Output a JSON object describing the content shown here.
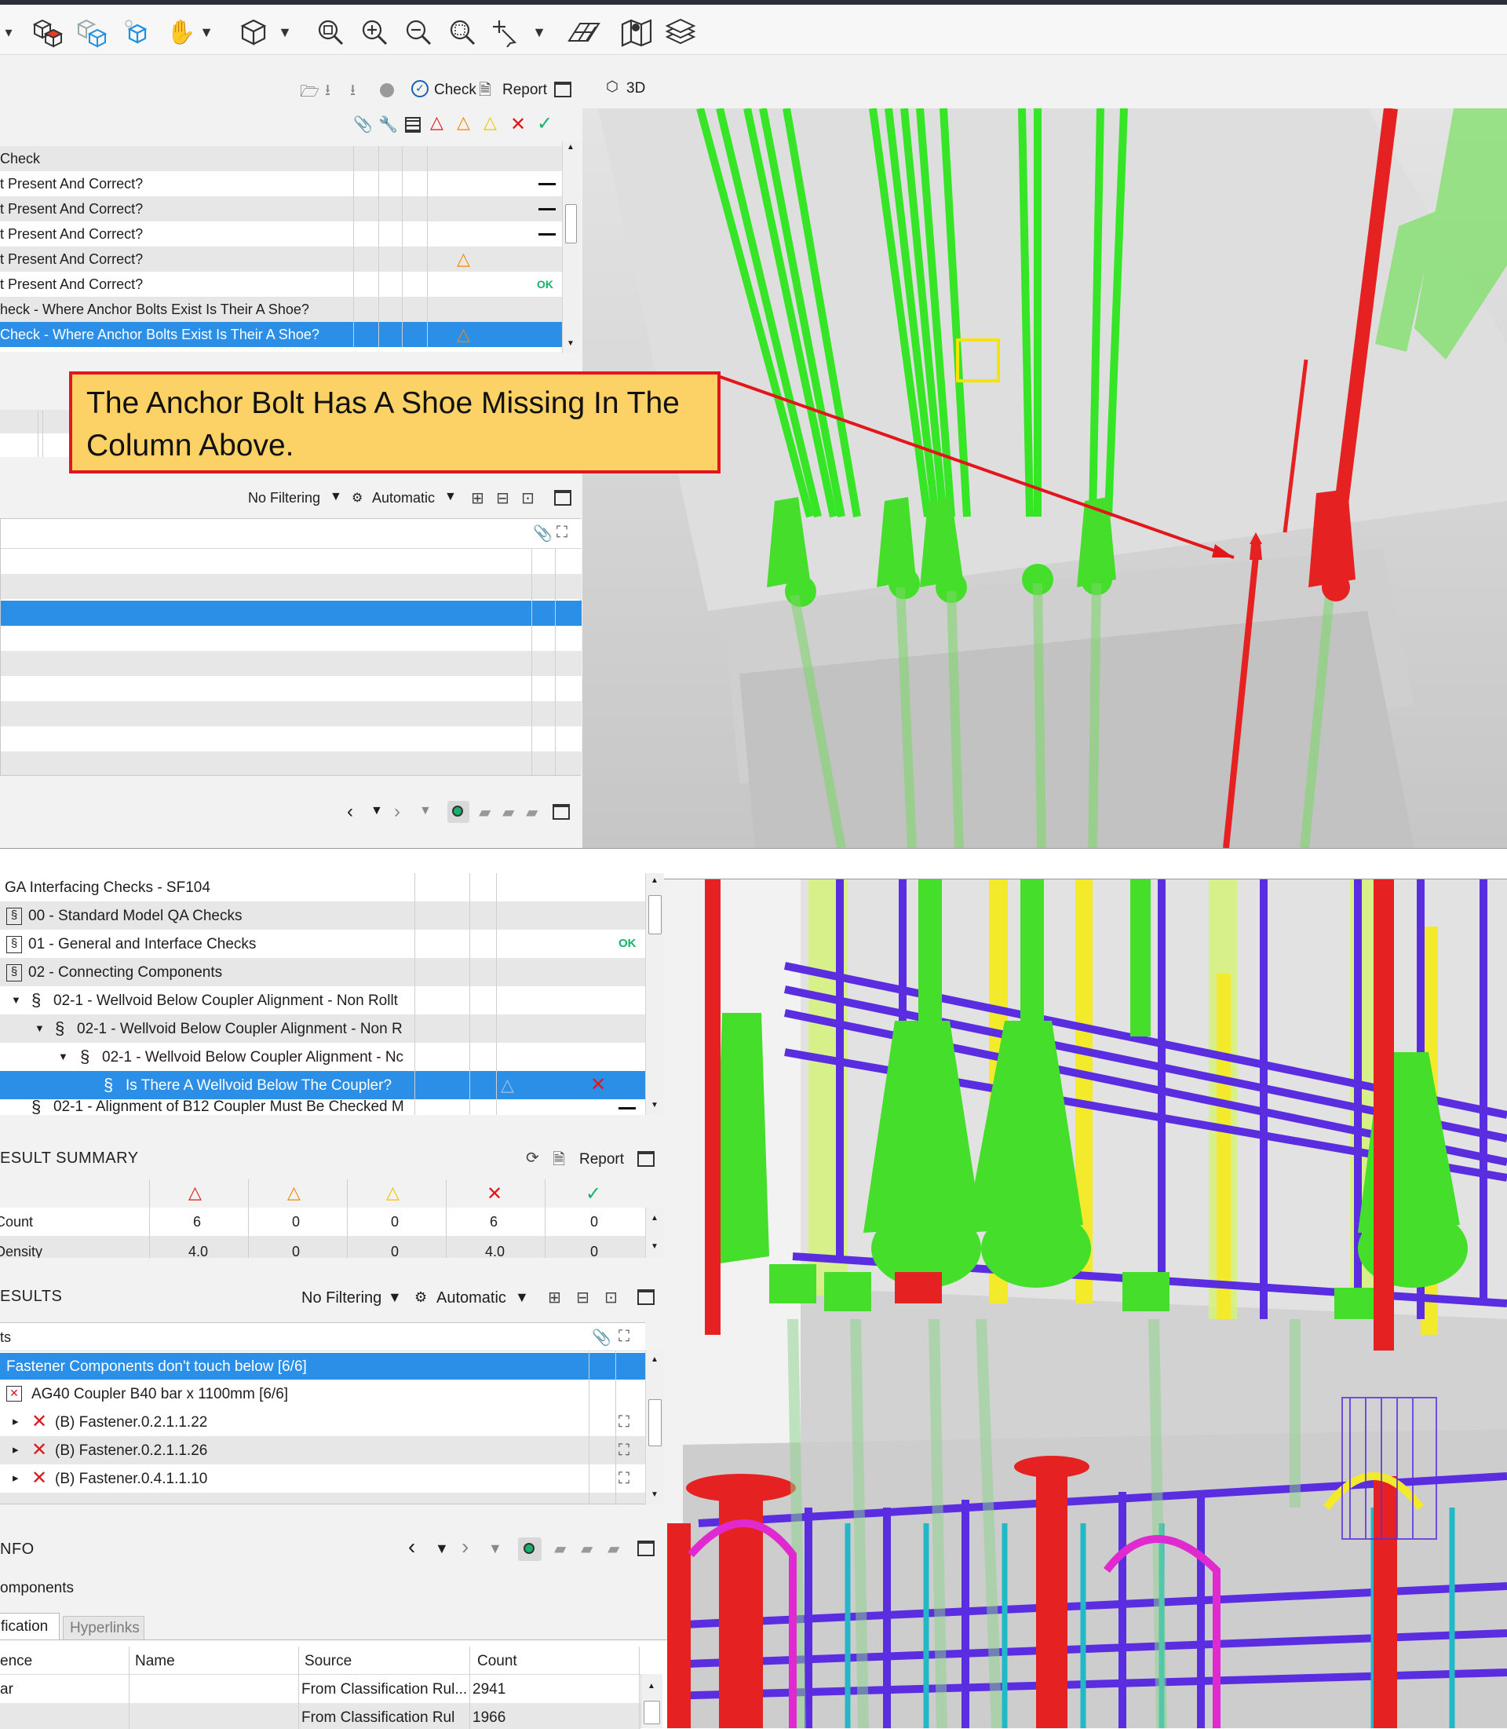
{
  "toolbar": {
    "icons": [
      "dropdown-arrow-icon",
      "boxes-icon",
      "boxes-blue-icon",
      "cube-blue-icon",
      "hand-tool-icon",
      "cube-outline-icon",
      "zoom-fit-icon",
      "zoom-in-icon",
      "zoom-out-icon",
      "zoom-window-icon",
      "select-tool-icon",
      "grid-plane-icon",
      "map-icon",
      "layers-icon"
    ]
  },
  "top_panel": {
    "checks_toolbar": {
      "check_label": "Check",
      "report_label": "Report"
    },
    "view_label": "3D",
    "rows": [
      {
        "label": "Check",
        "status": "",
        "style": "grey"
      },
      {
        "label": "t Present And Correct?",
        "status": "dash",
        "style": "white"
      },
      {
        "label": "t Present And Correct?",
        "status": "dash",
        "style": "grey"
      },
      {
        "label": "t Present And Correct?",
        "status": "dash",
        "style": "white"
      },
      {
        "label": "t Present And Correct?",
        "status": "warn",
        "style": "grey"
      },
      {
        "label": "t Present And Correct?",
        "status": "ok",
        "style": "white"
      },
      {
        "label": "heck - Where Anchor Bolts Exist Is Their A Shoe?",
        "status": "",
        "style": "grey"
      },
      {
        "label": "Check - Where Anchor Bolts Exist Is Their A Shoe?",
        "status": "warn",
        "style": "sel"
      }
    ],
    "ok_text": "OK",
    "filter_label": "No Filtering",
    "mode_label": "Automatic",
    "callout_text": "The Anchor Bolt Has A Shoe Missing In The Column Above."
  },
  "bottom_panel": {
    "tree_rows": [
      {
        "indent": 0,
        "expander": "",
        "icon": "",
        "label": "GA Interfacing Checks - SF104",
        "status": "",
        "style": "white"
      },
      {
        "indent": 0,
        "expander": "",
        "icon": "§",
        "label": "00 - Standard Model QA Checks",
        "status": "",
        "style": "grey"
      },
      {
        "indent": 0,
        "expander": "",
        "icon": "§",
        "label": "01 - General and Interface Checks",
        "status": "ok",
        "style": "white"
      },
      {
        "indent": 0,
        "expander": "",
        "icon": "§",
        "label": "02 - Connecting Components",
        "status": "",
        "style": "grey"
      },
      {
        "indent": 1,
        "expander": "▼",
        "icon": "§",
        "label": "02-1 - Wellvoid Below Coupler Alignment - Non Rollt",
        "status": "",
        "style": "white"
      },
      {
        "indent": 2,
        "expander": "▼",
        "icon": "§",
        "label": "02-1 - Wellvoid Below Coupler Alignment - Non R",
        "status": "",
        "style": "grey"
      },
      {
        "indent": 3,
        "expander": "▼",
        "icon": "§",
        "label": "02-1 - Wellvoid Below Coupler Alignment - Nc",
        "status": "",
        "style": "white"
      },
      {
        "indent": 4,
        "expander": "",
        "icon": "§",
        "label": "Is There A Wellvoid Below The Coupler?",
        "status": "fail",
        "style": "sel"
      },
      {
        "indent": 1,
        "expander": "",
        "icon": "§",
        "label": "02-1 - Alignment of B12 Coupler Must Be Checked M",
        "status": "dash",
        "style": "white"
      }
    ],
    "ok_text": "OK",
    "result_summary": {
      "title": "ESULT SUMMARY",
      "report_label": "Report",
      "rows": [
        {
          "label": "Count",
          "values": [
            "6",
            "0",
            "0",
            "6",
            "0"
          ]
        },
        {
          "label": "Density",
          "values": [
            "4.0",
            "0",
            "0",
            "4.0",
            "0"
          ]
        }
      ]
    },
    "results": {
      "title": "ESULTS",
      "filter_label": "No Filtering",
      "mode_label": "Automatic",
      "header_label": "ts",
      "rows": [
        {
          "expander": "",
          "icon": "",
          "label": "Fastener Components don't touch below [6/6]",
          "style": "sel"
        },
        {
          "expander": "",
          "icon": "boxed-x",
          "label": "AG40 Coupler B40 bar x 1100mm [6/6]",
          "style": "white"
        },
        {
          "expander": "▸",
          "icon": "x",
          "label": "(B) Fastener.0.2.1.1.22",
          "style": "white"
        },
        {
          "expander": "▸",
          "icon": "x",
          "label": "(B) Fastener.0.2.1.1.26",
          "style": "grey"
        },
        {
          "expander": "▸",
          "icon": "x",
          "label": "(B) Fastener.0.4.1.1.10",
          "style": "white"
        }
      ]
    },
    "info": {
      "title": "NFO",
      "subtitle": "omponents",
      "tabs": [
        "fication",
        "Hyperlinks"
      ],
      "columns": [
        "ence",
        "Name",
        "Source",
        "Count"
      ],
      "rows": [
        {
          "ref": "ar",
          "name": "",
          "source": "From Classification Rul...",
          "count": "2941"
        },
        {
          "ref": "",
          "name": "",
          "source": "From Classification Rul",
          "count": "1966"
        }
      ]
    }
  },
  "colors": {
    "selection": "#2b8fe8",
    "fail": "#e0161b",
    "warn": "#f08a00",
    "minor": "#f2c500",
    "ok": "#16b26b",
    "callout_bg": "#fcd165",
    "callout_border": "#e2161b"
  }
}
